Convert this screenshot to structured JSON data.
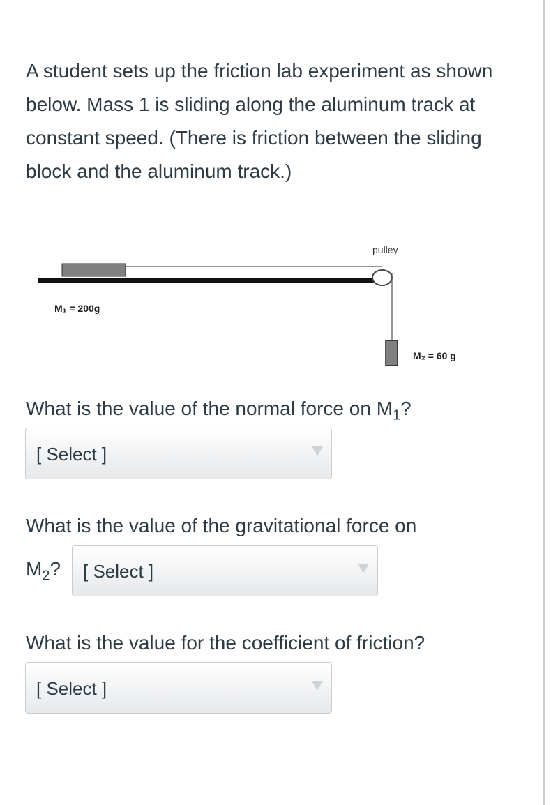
{
  "intro_text": "A student sets up the friction lab experiment as shown below.  Mass 1 is sliding along the aluminum track at constant speed.  (There is friction between the sliding block and the aluminum track.)",
  "figure": {
    "pulley_label": "pulley",
    "m1_label": "M₁ = 200g",
    "m2_label": "M₂ = 60 g"
  },
  "questions": {
    "q1": {
      "text_before": "What is the value of the normal force on M",
      "subscript": "1",
      "text_after": "?",
      "select_value": "[ Select ]"
    },
    "q2": {
      "text_line1": "What is the value of the gravitational force on",
      "text_line2_main": "M",
      "subscript": "2",
      "text_after": "?",
      "select_value": "[ Select ]"
    },
    "q3": {
      "text": "What is the value for the coefficient of friction?",
      "select_value": "[ Select ]"
    }
  }
}
